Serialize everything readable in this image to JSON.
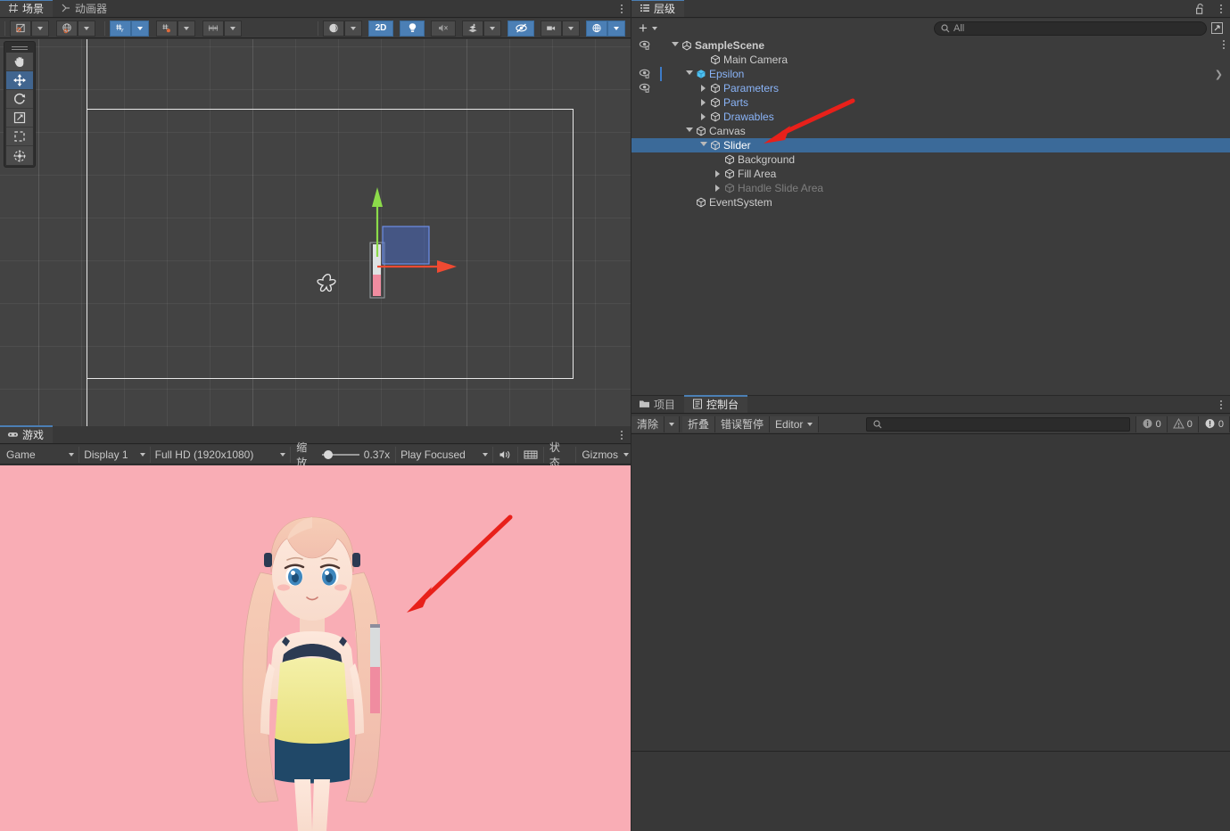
{
  "scene_view": {
    "tabs": [
      {
        "label": "场景",
        "icon": "grid-icon",
        "active": true
      },
      {
        "label": "动画器",
        "icon": "animator-icon",
        "active": false
      }
    ],
    "toolbar": {
      "tool_handle_position": {
        "icon": "pivot-center-icon",
        "label": ""
      },
      "tool_handle_rotation": {
        "icon": "global-local-icon",
        "label": ""
      },
      "grid_visibility": {
        "icon": "grid-y-icon",
        "label": "",
        "active": true
      },
      "grid_snapping": {
        "icon": "grid-snap-icon",
        "label": "",
        "active": false
      },
      "snap_increment": {
        "icon": "snap-ruler-icon",
        "label": "",
        "active": false
      },
      "shading_mode": {
        "icon": "shaded-sphere-icon",
        "label": ""
      },
      "mode_2d": {
        "label": "2D",
        "active": true
      },
      "scene_lighting": {
        "icon": "lightbulb-icon",
        "active": true
      },
      "scene_audio": {
        "icon": "audio-muted-icon",
        "active": false
      },
      "fx": {
        "icon": "fx-layers-icon",
        "active": false
      },
      "hidden_objects": {
        "icon": "eye-slash-icon",
        "active": true
      },
      "camera_settings": {
        "icon": "camera-icon",
        "active": false
      },
      "scene_view_gizmos": {
        "icon": "gizmo-globe-icon",
        "active": true
      }
    },
    "toolbox": [
      {
        "name": "hand-tool",
        "icon": "hand-icon",
        "active": false
      },
      {
        "name": "move-tool",
        "icon": "move-arrows-icon",
        "active": true
      },
      {
        "name": "rotate-tool",
        "icon": "rotate-icon",
        "active": false
      },
      {
        "name": "scale-tool",
        "icon": "scale-icon",
        "active": false
      },
      {
        "name": "rect-tool",
        "icon": "rect-transform-icon",
        "active": false
      },
      {
        "name": "transform-tool",
        "icon": "transform-globe-icon",
        "active": false
      }
    ],
    "gizmo": {
      "y_axis_color": "#8cdb4a",
      "x_axis_color": "#f04a32",
      "z_plane_color": "#4a6fd4",
      "slider_track_color": "#d8dbdc",
      "slider_fill_color": "#f08ca0",
      "pivot_marker": "rotation-pivot-icon"
    }
  },
  "game_view": {
    "tabs": [
      {
        "label": "游戏",
        "icon": "gamepad-icon",
        "active": true
      }
    ],
    "toolbar": {
      "play_mode_target": "Game",
      "display": "Display 1",
      "resolution": "Full HD (1920x1080)",
      "scale_label": "缩放",
      "scale_value": "0.37x",
      "scale_percent": 18,
      "focus_mode": "Play Focused",
      "mute_audio": {
        "icon": "speaker-icon"
      },
      "stats_grid": {
        "icon": "grid-stats-icon"
      },
      "stats": "状态",
      "gizmos": "Gizmos"
    },
    "canvas": {
      "background_color": "#f9adb5",
      "character": "live2d-anime-character",
      "slider": {
        "track_color": "#d9dcdd",
        "fill_color": "#f08ca0",
        "handle_color": "#8a8a99",
        "value_percent": 52
      }
    }
  },
  "hierarchy": {
    "tabs": [
      {
        "label": "层级",
        "icon": "hierarchy-icon",
        "active": true
      }
    ],
    "toolbar": {
      "create_label": "+",
      "search_placeholder": "All",
      "search_value": ""
    },
    "lock_icon": "lock-open-icon",
    "rows": [
      {
        "label": "SampleScene",
        "depth": 0,
        "icon": "unity-scene-icon",
        "expanded": true,
        "eye": true,
        "bold": true,
        "style": "normal",
        "kebab": true
      },
      {
        "label": "Main Camera",
        "depth": 2,
        "icon": "gameobject-icon",
        "expanded": null,
        "eye": false,
        "style": "normal"
      },
      {
        "label": "Epsilon",
        "depth": 1,
        "icon": "prefab-icon",
        "expanded": true,
        "eye": true,
        "style": "blue",
        "pipe": true,
        "chevron": true
      },
      {
        "label": "Parameters",
        "depth": 2,
        "icon": "gameobject-icon",
        "expanded": false,
        "eye": true,
        "style": "blue"
      },
      {
        "label": "Parts",
        "depth": 2,
        "icon": "gameobject-icon",
        "expanded": false,
        "eye": false,
        "style": "blue"
      },
      {
        "label": "Drawables",
        "depth": 2,
        "icon": "gameobject-icon",
        "expanded": false,
        "eye": false,
        "style": "blue"
      },
      {
        "label": "Canvas",
        "depth": 1,
        "icon": "gameobject-icon",
        "expanded": true,
        "eye": false,
        "style": "normal"
      },
      {
        "label": "Slider",
        "depth": 2,
        "icon": "gameobject-icon",
        "expanded": true,
        "eye": false,
        "style": "normal",
        "selected": true
      },
      {
        "label": "Background",
        "depth": 3,
        "icon": "gameobject-icon",
        "expanded": null,
        "eye": false,
        "style": "normal"
      },
      {
        "label": "Fill Area",
        "depth": 3,
        "icon": "gameobject-icon",
        "expanded": false,
        "eye": false,
        "style": "normal"
      },
      {
        "label": "Handle Slide Area",
        "depth": 3,
        "icon": "gameobject-icon",
        "expanded": false,
        "eye": false,
        "style": "dim"
      },
      {
        "label": "EventSystem",
        "depth": 1,
        "icon": "gameobject-icon",
        "expanded": null,
        "eye": false,
        "style": "normal"
      }
    ]
  },
  "project_console": {
    "tabs": [
      {
        "label": "项目",
        "icon": "folder-icon",
        "active": false
      },
      {
        "label": "控制台",
        "icon": "console-icon",
        "active": true
      }
    ],
    "toolbar": {
      "clear": "清除",
      "collapse": "折叠",
      "error_pause": "错误暂停",
      "editor": "Editor",
      "search_value": "",
      "counts": {
        "info": "0",
        "warning": "0",
        "error": "0"
      }
    }
  },
  "annotations": {
    "arrow_color": "#e8201a",
    "arrows": [
      {
        "name": "arrow-to-slider-hierarchy"
      },
      {
        "name": "arrow-to-slider-gameview"
      }
    ]
  }
}
